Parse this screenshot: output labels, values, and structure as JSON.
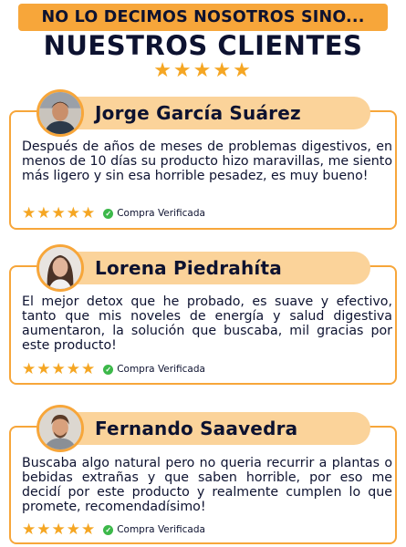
{
  "header": {
    "banner": "NO LO DECIMOS NOSOTROS SINO...",
    "title": "NUESTROS CLIENTES",
    "stars": "★★★★★"
  },
  "colors": {
    "accent": "#f7a63a",
    "pill": "#fbd39a",
    "text": "#0d1230",
    "star": "#f5a623",
    "check": "#3cb84a"
  },
  "reviews": [
    {
      "name": "Jorge García Suárez",
      "text": "Después de años de meses de problemas digestivos, en menos de 10 días su producto hizo maravillas, me siento más ligero y sin esa horrible pesadez, es muy bueno!",
      "stars": "★★★★★",
      "verified": "Compra Verificada",
      "rating": 5,
      "avatar_icon": "man-avatar-icon"
    },
    {
      "name": "Lorena Piedrahíta",
      "text": "El mejor detox que he probado, es suave y efectivo, tanto que mis noveles de energía y salud digestiva aumentaron, la solución que buscaba, mil gracias por este producto!",
      "stars": "★★★★★",
      "verified": "Compra Verificada",
      "rating": 5,
      "avatar_icon": "woman-avatar-icon"
    },
    {
      "name": "Fernando Saavedra",
      "text": "Buscaba algo natural pero no queria recurrir a plantas o bebidas extrañas y que saben horrible, por eso me decidí por este producto y realmente cumplen lo que promete, recomendadísimo!",
      "stars": "★★★★★",
      "verified": "Compra Verificada",
      "rating": 5,
      "avatar_icon": "man-avatar-icon"
    }
  ]
}
